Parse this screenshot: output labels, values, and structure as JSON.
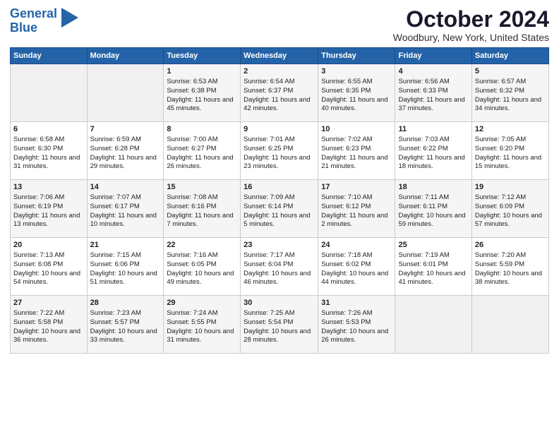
{
  "header": {
    "logo_line1": "General",
    "logo_line2": "Blue",
    "month": "October 2024",
    "location": "Woodbury, New York, United States"
  },
  "days_of_week": [
    "Sunday",
    "Monday",
    "Tuesday",
    "Wednesday",
    "Thursday",
    "Friday",
    "Saturday"
  ],
  "weeks": [
    [
      {
        "day": "",
        "empty": true
      },
      {
        "day": "",
        "empty": true
      },
      {
        "day": "1",
        "sunrise": "6:53 AM",
        "sunset": "6:38 PM",
        "daylight": "11 hours and 45 minutes."
      },
      {
        "day": "2",
        "sunrise": "6:54 AM",
        "sunset": "6:37 PM",
        "daylight": "11 hours and 42 minutes."
      },
      {
        "day": "3",
        "sunrise": "6:55 AM",
        "sunset": "6:35 PM",
        "daylight": "11 hours and 40 minutes."
      },
      {
        "day": "4",
        "sunrise": "6:56 AM",
        "sunset": "6:33 PM",
        "daylight": "11 hours and 37 minutes."
      },
      {
        "day": "5",
        "sunrise": "6:57 AM",
        "sunset": "6:32 PM",
        "daylight": "11 hours and 34 minutes."
      }
    ],
    [
      {
        "day": "6",
        "sunrise": "6:58 AM",
        "sunset": "6:30 PM",
        "daylight": "11 hours and 31 minutes."
      },
      {
        "day": "7",
        "sunrise": "6:59 AM",
        "sunset": "6:28 PM",
        "daylight": "11 hours and 29 minutes."
      },
      {
        "day": "8",
        "sunrise": "7:00 AM",
        "sunset": "6:27 PM",
        "daylight": "11 hours and 26 minutes."
      },
      {
        "day": "9",
        "sunrise": "7:01 AM",
        "sunset": "6:25 PM",
        "daylight": "11 hours and 23 minutes."
      },
      {
        "day": "10",
        "sunrise": "7:02 AM",
        "sunset": "6:23 PM",
        "daylight": "11 hours and 21 minutes."
      },
      {
        "day": "11",
        "sunrise": "7:03 AM",
        "sunset": "6:22 PM",
        "daylight": "11 hours and 18 minutes."
      },
      {
        "day": "12",
        "sunrise": "7:05 AM",
        "sunset": "6:20 PM",
        "daylight": "11 hours and 15 minutes."
      }
    ],
    [
      {
        "day": "13",
        "sunrise": "7:06 AM",
        "sunset": "6:19 PM",
        "daylight": "11 hours and 13 minutes."
      },
      {
        "day": "14",
        "sunrise": "7:07 AM",
        "sunset": "6:17 PM",
        "daylight": "11 hours and 10 minutes."
      },
      {
        "day": "15",
        "sunrise": "7:08 AM",
        "sunset": "6:16 PM",
        "daylight": "11 hours and 7 minutes."
      },
      {
        "day": "16",
        "sunrise": "7:09 AM",
        "sunset": "6:14 PM",
        "daylight": "11 hours and 5 minutes."
      },
      {
        "day": "17",
        "sunrise": "7:10 AM",
        "sunset": "6:12 PM",
        "daylight": "11 hours and 2 minutes."
      },
      {
        "day": "18",
        "sunrise": "7:11 AM",
        "sunset": "6:11 PM",
        "daylight": "10 hours and 59 minutes."
      },
      {
        "day": "19",
        "sunrise": "7:12 AM",
        "sunset": "6:09 PM",
        "daylight": "10 hours and 57 minutes."
      }
    ],
    [
      {
        "day": "20",
        "sunrise": "7:13 AM",
        "sunset": "6:08 PM",
        "daylight": "10 hours and 54 minutes."
      },
      {
        "day": "21",
        "sunrise": "7:15 AM",
        "sunset": "6:06 PM",
        "daylight": "10 hours and 51 minutes."
      },
      {
        "day": "22",
        "sunrise": "7:16 AM",
        "sunset": "6:05 PM",
        "daylight": "10 hours and 49 minutes."
      },
      {
        "day": "23",
        "sunrise": "7:17 AM",
        "sunset": "6:04 PM",
        "daylight": "10 hours and 46 minutes."
      },
      {
        "day": "24",
        "sunrise": "7:18 AM",
        "sunset": "6:02 PM",
        "daylight": "10 hours and 44 minutes."
      },
      {
        "day": "25",
        "sunrise": "7:19 AM",
        "sunset": "6:01 PM",
        "daylight": "10 hours and 41 minutes."
      },
      {
        "day": "26",
        "sunrise": "7:20 AM",
        "sunset": "5:59 PM",
        "daylight": "10 hours and 38 minutes."
      }
    ],
    [
      {
        "day": "27",
        "sunrise": "7:22 AM",
        "sunset": "5:58 PM",
        "daylight": "10 hours and 36 minutes."
      },
      {
        "day": "28",
        "sunrise": "7:23 AM",
        "sunset": "5:57 PM",
        "daylight": "10 hours and 33 minutes."
      },
      {
        "day": "29",
        "sunrise": "7:24 AM",
        "sunset": "5:55 PM",
        "daylight": "10 hours and 31 minutes."
      },
      {
        "day": "30",
        "sunrise": "7:25 AM",
        "sunset": "5:54 PM",
        "daylight": "10 hours and 28 minutes."
      },
      {
        "day": "31",
        "sunrise": "7:26 AM",
        "sunset": "5:53 PM",
        "daylight": "10 hours and 26 minutes."
      },
      {
        "day": "",
        "empty": true
      },
      {
        "day": "",
        "empty": true
      }
    ]
  ]
}
